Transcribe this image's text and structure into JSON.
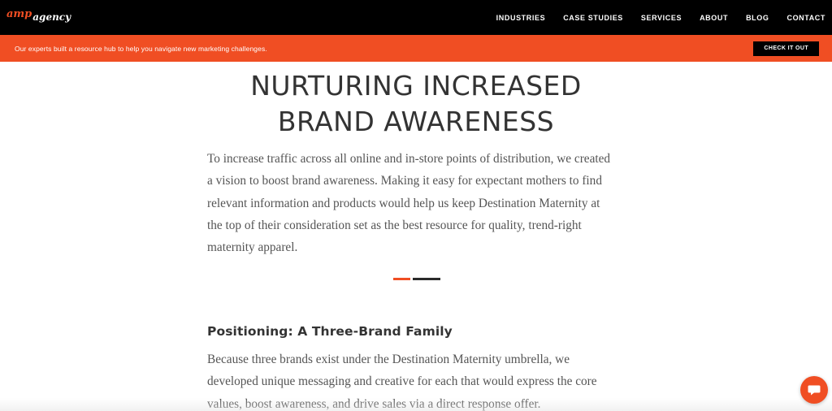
{
  "brand": {
    "logo_top": "amp",
    "logo_bottom": "agency"
  },
  "nav": {
    "items": [
      {
        "label": "INDUSTRIES"
      },
      {
        "label": "CASE STUDIES"
      },
      {
        "label": "SERVICES"
      },
      {
        "label": "ABOUT"
      },
      {
        "label": "BLOG"
      },
      {
        "label": "CONTACT"
      }
    ]
  },
  "promo": {
    "text": "Our experts built a resource hub to help you navigate new marketing challenges.",
    "button_label": "CHECK IT OUT"
  },
  "hero": {
    "title_line1": "NURTURING INCREASED",
    "title_line2": "BRAND AWARENESS",
    "paragraph": "To increase traffic across all online and in-store points of distribution, we created a vision to boost brand awareness. Making it easy for expectant mothers to find relevant information and products would help us keep Destination Maternity at the top of their consideration set as the best resource for quality, trend-right maternity apparel."
  },
  "section": {
    "heading": "Positioning: A Three-Brand Family",
    "paragraph": "Because three brands exist under the Destination Maternity umbrella, we developed unique messaging and creative for each that would express the core values, boost awareness, and drive sales via a direct response offer."
  },
  "chat": {
    "icon": "chat-bubble-icon"
  },
  "colors": {
    "accent": "#f04e23",
    "nav_bg": "#000000",
    "text": "#333333",
    "body_text": "#555555"
  }
}
